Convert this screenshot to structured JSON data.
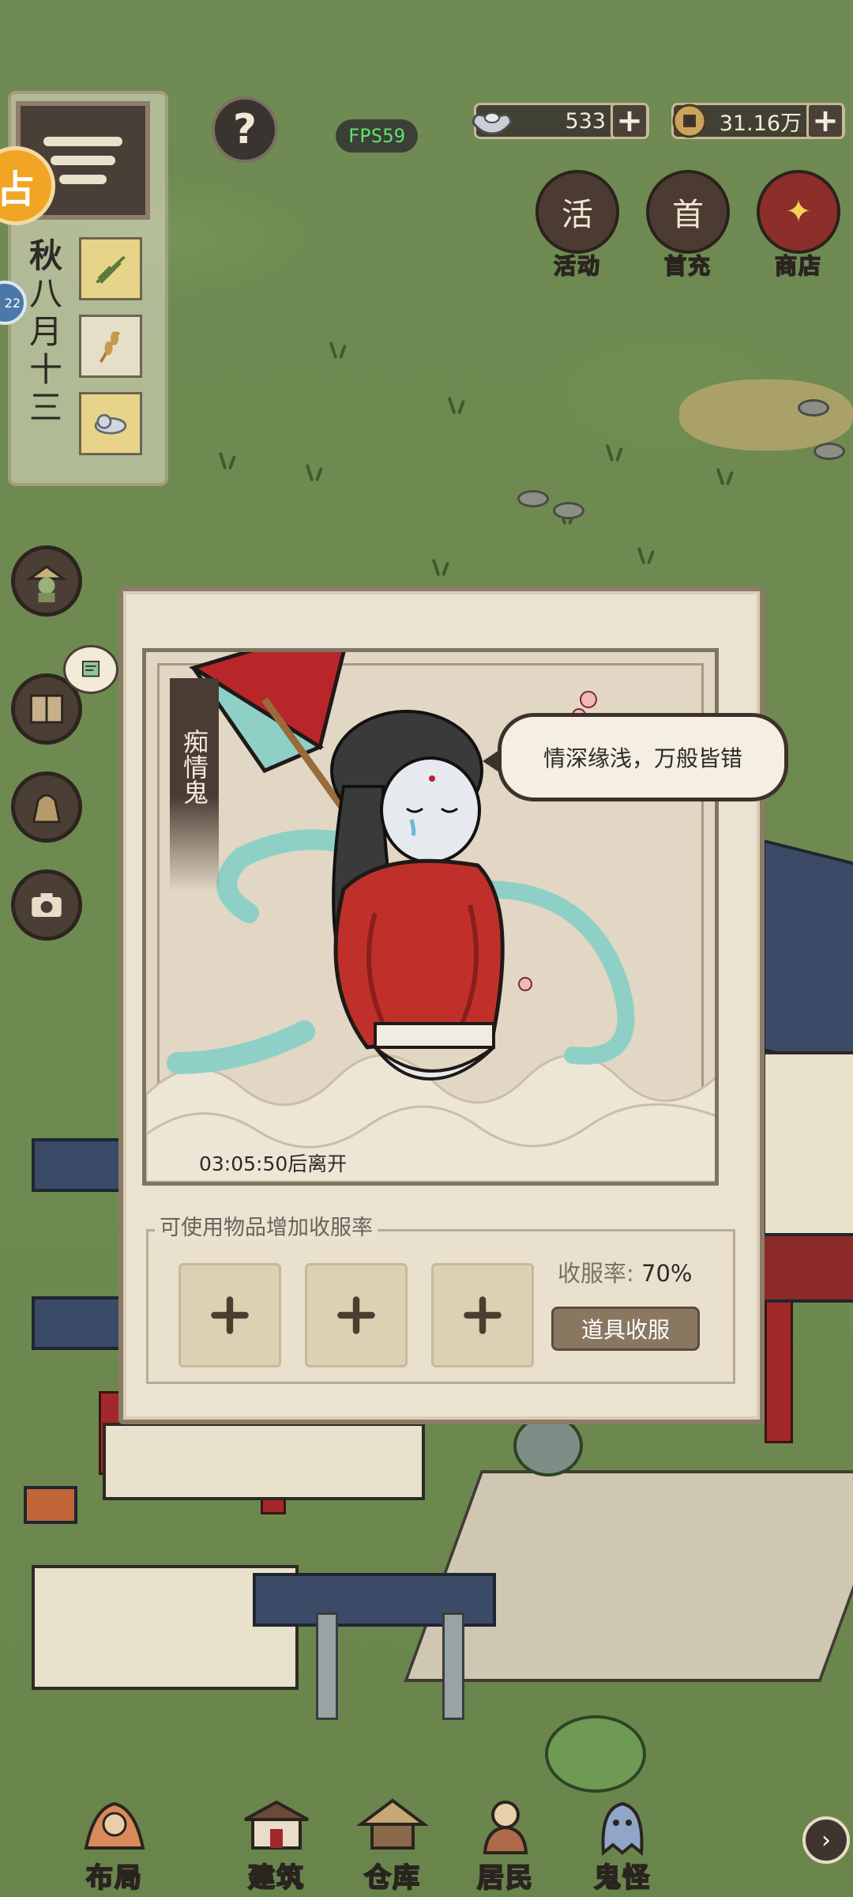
{
  "hud": {
    "fps": "FPS59",
    "help_label": "?",
    "season": "秋",
    "date": "八月\n十三",
    "silver": "533",
    "coins": "31.16万",
    "plus_label": "+",
    "top_icons": [
      {
        "label": "活动",
        "glyph": "活",
        "icon": "scroll-icon"
      },
      {
        "label": "首充",
        "glyph": "首",
        "icon": "money-bag-icon"
      },
      {
        "label": "商店",
        "glyph": "✦",
        "icon": "shop-icon"
      }
    ],
    "side_orange": "占",
    "side_blue": "22"
  },
  "dialog": {
    "ghost_name": "痴情鬼",
    "speech": "情深缘浅，万般皆错",
    "timer": "03:05:50后离开",
    "items_title": "可使用物品增加收服率",
    "rate_label": "收服率: ",
    "rate_value": "70%",
    "capture_button": "道具收服",
    "slot_count": 3
  },
  "nav": {
    "items": [
      {
        "label": "布局",
        "icon": "layout-icon"
      },
      {
        "label": "建筑",
        "icon": "building-icon"
      },
      {
        "label": "仓库",
        "icon": "warehouse-icon"
      },
      {
        "label": "居民",
        "icon": "resident-icon"
      },
      {
        "label": "鬼怪",
        "icon": "ghost-icon"
      }
    ],
    "more_label": "›"
  },
  "colors": {
    "accent_red": "#b9262a",
    "teal": "#8fd0c6",
    "panel": "#ebe3d1",
    "fps_green": "#5fe26a"
  }
}
